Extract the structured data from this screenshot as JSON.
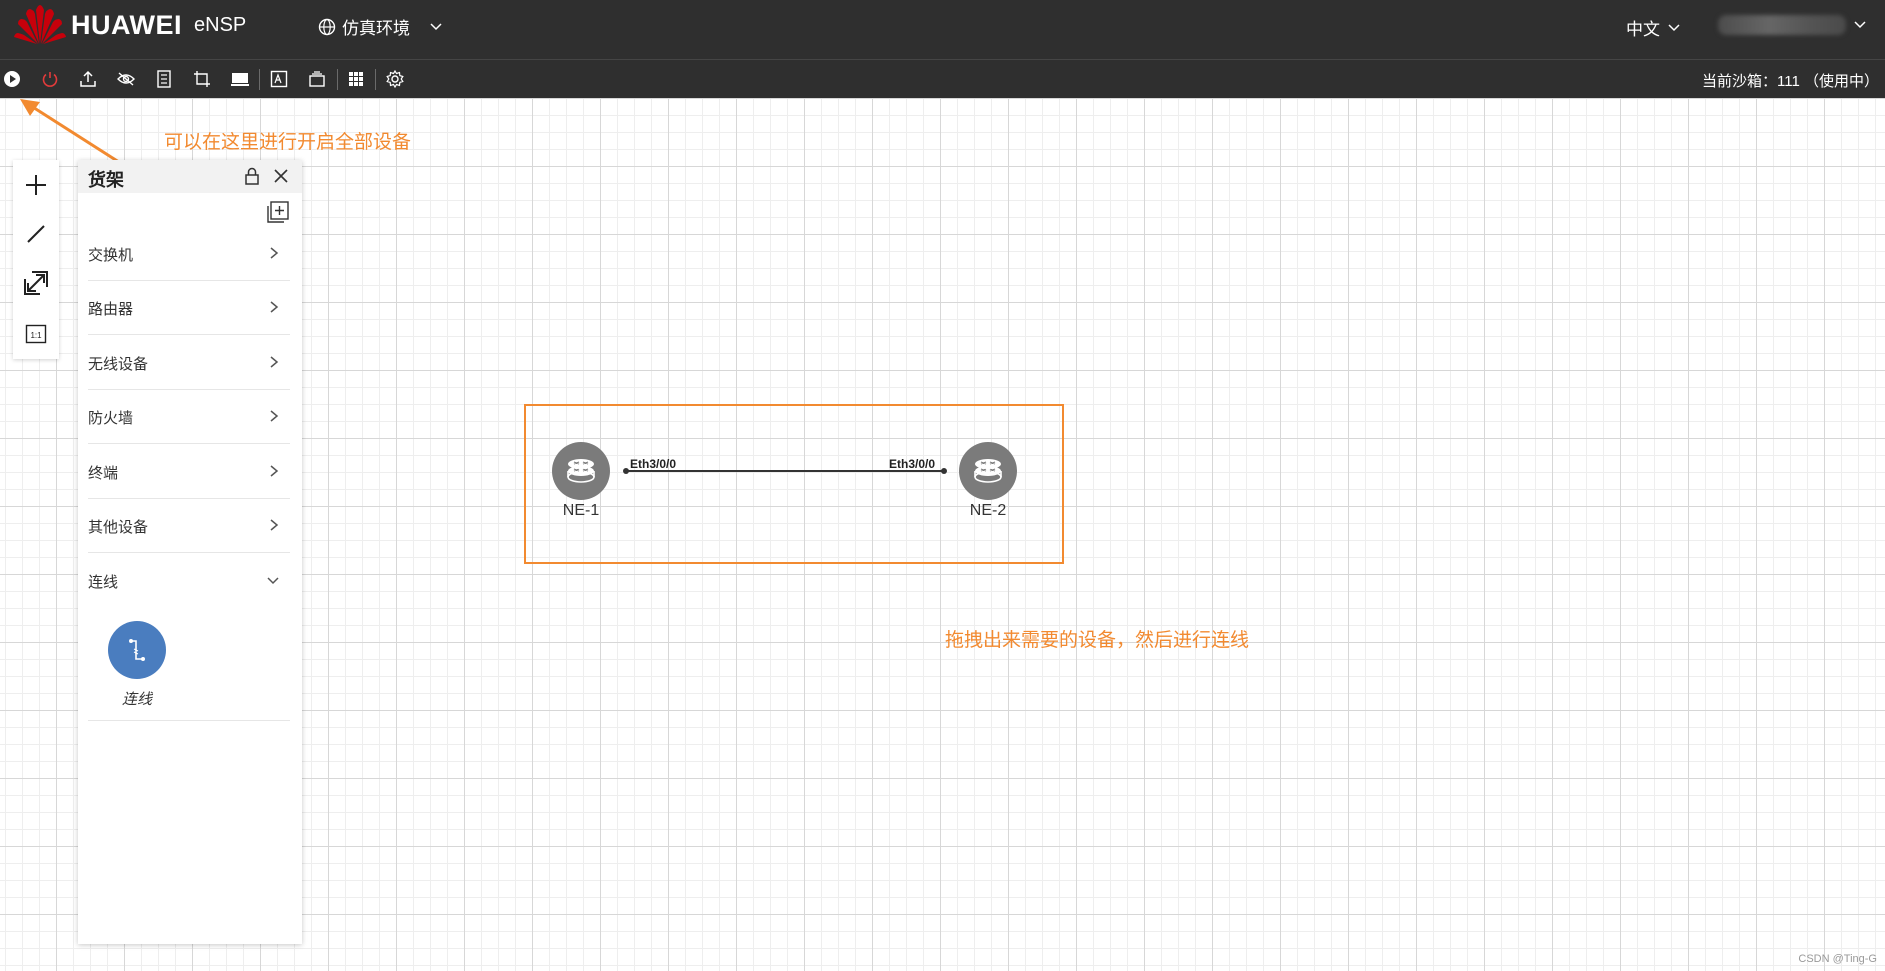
{
  "header": {
    "brand": "HUAWEI",
    "product": "eNSP",
    "environment": "仿真环境",
    "language": "中文",
    "user_masked": "",
    "brand_color": "#c7000b"
  },
  "toolbar": {
    "sandbox_status": "当前沙箱：111 （使用中）",
    "buttons": [
      "start-all",
      "stop-all",
      "upload",
      "hide",
      "notes",
      "crop",
      "screen",
      "text",
      "layer",
      "grid",
      "settings"
    ]
  },
  "annotations": {
    "start_hint": "可以在这里进行开启全部设备",
    "drag_hint": "拖拽出来需要的设备，然后进行连线",
    "accent": "#f28a30"
  },
  "shelf": {
    "title": "货架",
    "categories": [
      {
        "label": "交换机",
        "expanded": false
      },
      {
        "label": "路由器",
        "expanded": false
      },
      {
        "label": "无线设备",
        "expanded": false
      },
      {
        "label": "防火墙",
        "expanded": false
      },
      {
        "label": "终端",
        "expanded": false
      },
      {
        "label": "其他设备",
        "expanded": false
      },
      {
        "label": "连线",
        "expanded": true
      }
    ],
    "link_tool_label": "连线"
  },
  "topology": {
    "devices": [
      {
        "name": "NE-1",
        "port": "Eth3/0/0"
      },
      {
        "name": "NE-2",
        "port": "Eth3/0/0"
      }
    ]
  },
  "watermark": "CSDN @Ting-G"
}
